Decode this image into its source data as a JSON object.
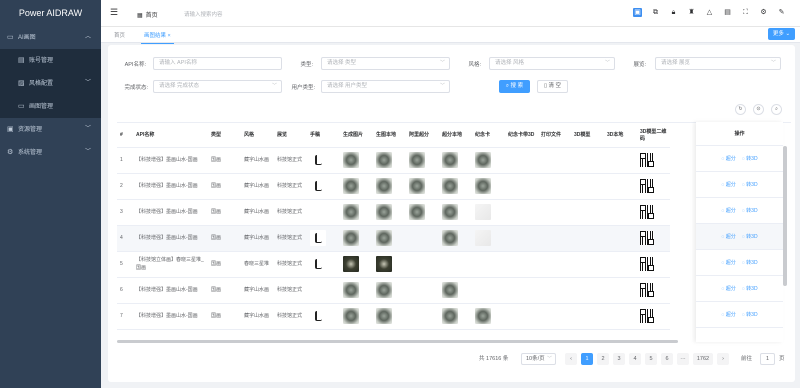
{
  "app": {
    "title": "Power AIDRAW"
  },
  "sidebar": {
    "items": [
      {
        "label": "AI画图",
        "icon": "monitor-icon",
        "expanded": true
      },
      {
        "label": "账号管理",
        "icon": "user-card-icon",
        "sub": true
      },
      {
        "label": "风格配置",
        "icon": "image-icon",
        "sub": true
      },
      {
        "label": "画图管理",
        "icon": "monitor-icon",
        "sub": true
      },
      {
        "label": "资源管理",
        "icon": "folder-icon"
      },
      {
        "label": "系统管理",
        "icon": "gear-icon"
      }
    ]
  },
  "header": {
    "breadcrumb": "首页",
    "search_placeholder": "请输入搜索内容",
    "icons": [
      "window-icon",
      "screenshot-icon",
      "lock-icon",
      "shirt-icon",
      "bell-icon",
      "document-icon",
      "fullscreen-icon",
      "settings-icon",
      "brush-icon"
    ]
  },
  "tabs": [
    {
      "label": "首页",
      "active": false
    },
    {
      "label": "画图结果",
      "active": true,
      "closable": "×"
    }
  ],
  "toolbar": {
    "more_label": "更多",
    "more_caret": "⌄"
  },
  "filters": {
    "api_label": "API名称:",
    "api_placeholder": "请输入 API名称",
    "type_label": "类型:",
    "type_placeholder": "请选择 类型",
    "style_label": "风格:",
    "style_placeholder": "请选择 风格",
    "frame_label": "展览:",
    "frame_placeholder": "请选择 展览",
    "status_label": "完成状态:",
    "status_placeholder": "请选择 完成状态",
    "usertype_label": "用户类型:",
    "usertype_placeholder": "请选择 用户类型",
    "search_label": "搜 索",
    "reset_label": "清 空"
  },
  "table": {
    "columns": [
      "#",
      "API名称",
      "类型",
      "风格",
      "展览",
      "手稿",
      "生成图片",
      "生图本地",
      "阿里超分",
      "超分本地",
      "纪念卡",
      "纪念卡带3D",
      "打印文件",
      "3D模型",
      "3D本地",
      "3D模型二维码",
      "操作"
    ],
    "rows": [
      {
        "no": "1",
        "api": "【科技增强】墨画山水-国画",
        "type": "国画",
        "style": "藏字山水画",
        "frame": "科技馆正式",
        "sketch": "ink",
        "gen": "stone",
        "genl": "stone",
        "ali": "stone",
        "alil": "stone",
        "card": "stone",
        "qr": true
      },
      {
        "no": "2",
        "api": "【科技增强】墨画山水-国画",
        "type": "国画",
        "style": "藏字山水画",
        "frame": "科技馆正式",
        "sketch": "ink",
        "gen": "stone",
        "genl": "stone",
        "ali": "stone",
        "alil": "stone",
        "card": "stone",
        "qr": true
      },
      {
        "no": "3",
        "api": "【科技增强】墨画山水-国画",
        "type": "国画",
        "style": "藏字山水画",
        "frame": "科技馆正式",
        "sketch": "",
        "gen": "stone",
        "genl": "stone",
        "ali": "stone",
        "alil": "stone",
        "card": "light",
        "qr": true
      },
      {
        "no": "4",
        "api": "【科技增强】墨画山水-国画",
        "type": "国画",
        "style": "藏字山水画",
        "frame": "科技馆正式",
        "sketch": "ink",
        "gen": "stone",
        "genl": "stone",
        "ali": "",
        "alil": "stone",
        "card": "light",
        "qr": true
      },
      {
        "no": "5",
        "api": "【科技馆立体画】春晓三星堆_国画",
        "type": "国画",
        "style": "春晓三星堆",
        "frame": "科技馆正式",
        "sketch": "ink",
        "gen": "dark",
        "genl": "dark",
        "ali": "",
        "alil": "",
        "card": "",
        "qr": true
      },
      {
        "no": "6",
        "api": "【科技增强】墨画山水-国画",
        "type": "国画",
        "style": "藏字山水画",
        "frame": "科技馆正式",
        "sketch": "",
        "gen": "stone",
        "genl": "stone",
        "ali": "",
        "alil": "stone",
        "card": "",
        "qr": true
      },
      {
        "no": "7",
        "api": "【科技增强】墨画山水-国画",
        "type": "国画",
        "style": "藏字山水画",
        "frame": "科技馆正式",
        "sketch": "ink",
        "gen": "stone",
        "genl": "stone",
        "ali": "",
        "alil": "stone",
        "card": "stone",
        "qr": true
      }
    ],
    "actions": {
      "divide": "◌ 超分",
      "convert": "◌ 转3D"
    }
  },
  "pagination": {
    "total": "共 17616 条",
    "size": "10条/页",
    "pages": [
      "1",
      "2",
      "3",
      "4",
      "5",
      "6"
    ],
    "ellipsis": "···",
    "last": "1762",
    "prev": "‹",
    "next": "›",
    "goto_label": "前往",
    "goto_value": "1",
    "page_suffix": "页"
  }
}
